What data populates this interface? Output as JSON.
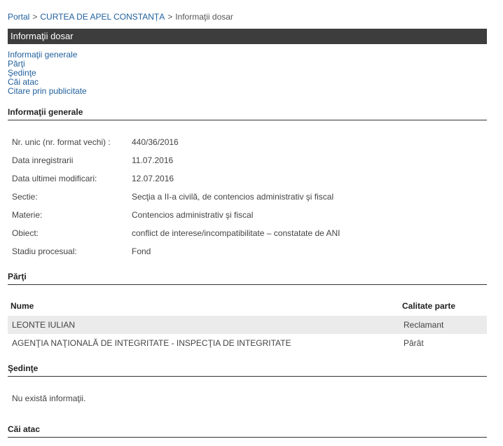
{
  "breadcrumb": {
    "items": [
      "Portal",
      "CURTEA DE APEL CONSTANȚA",
      "Informaţii dosar"
    ],
    "separator": ">"
  },
  "page_title": "Informaţii dosar",
  "quicknav": [
    "Informaţii generale",
    "Părţi",
    "Şedinţe",
    "Căi atac",
    "Citare prin publicitate"
  ],
  "sections": {
    "general": "Informaţii generale",
    "parties": "Părţi",
    "hearings": "Şedinţe",
    "appeals": "Căi atac"
  },
  "general_info": [
    {
      "label": "Nr. unic (nr. format vechi) :",
      "value": "440/36/2016"
    },
    {
      "label": "Data inregistrarii",
      "value": "11.07.2016"
    },
    {
      "label": "Data ultimei modificari:",
      "value": "12.07.2016"
    },
    {
      "label": "Sectie:",
      "value": "Secţia a II-a civilă, de contencios administrativ şi fiscal"
    },
    {
      "label": "Materie:",
      "value": "Contencios administrativ şi fiscal"
    },
    {
      "label": "Obiect:",
      "value": "conflict de interese/incompatibilitate – constatate de ANI"
    },
    {
      "label": "Stadiu procesual:",
      "value": "Fond"
    }
  ],
  "parties": {
    "columns": [
      "Nume",
      "Calitate parte"
    ],
    "rows": [
      {
        "name": "LEONTE IULIAN",
        "role": "Reclamant"
      },
      {
        "name": "AGENŢIA NAŢIONALĂ DE INTEGRITATE - INSPECŢIA DE INTEGRITATE",
        "role": "Pârât"
      }
    ]
  },
  "hearings_empty": "Nu există informaţii.",
  "colors": {
    "title_bar": "#3d3d3d",
    "link": "#1f5f9c",
    "row_alt": "#ebebeb"
  }
}
